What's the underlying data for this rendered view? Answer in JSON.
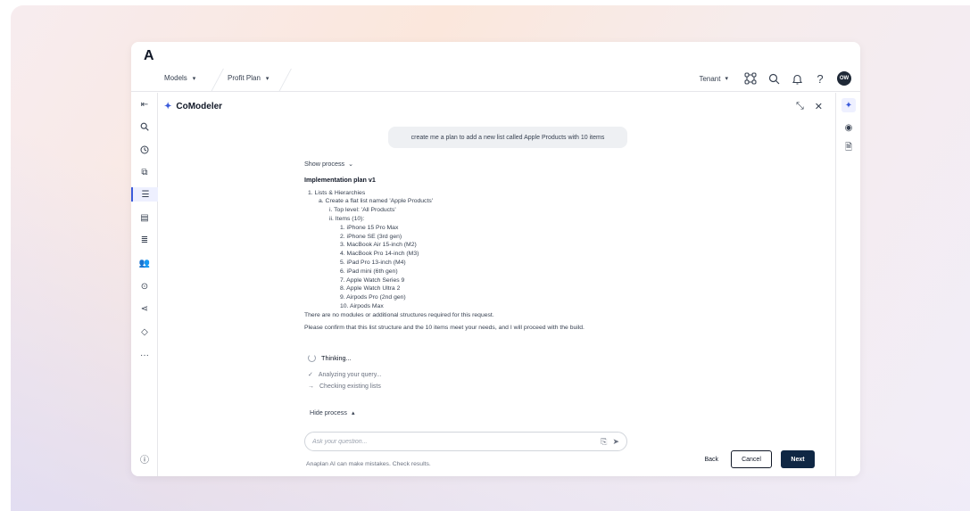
{
  "app": {
    "logo": "A"
  },
  "nav": {
    "items": [
      {
        "label": "Models"
      },
      {
        "label": "Profit Plan"
      }
    ],
    "tenant": "Tenant",
    "avatar_initials": "OW"
  },
  "panel": {
    "title": "CoModeler"
  },
  "chat": {
    "user_message": "create me a plan to add a new list called Apple Products with 10 items",
    "show_process": "Show process",
    "plan_title": "Implementation plan v1",
    "plan_lines": [
      {
        "level": 0,
        "text": "1. Lists & Hierarchies"
      },
      {
        "level": 1,
        "text": "a. Create a flat list named 'Apple Products'"
      },
      {
        "level": 2,
        "text": "i. Top level: 'All Products'"
      },
      {
        "level": 2,
        "text": "ii. Items (10):"
      },
      {
        "level": 3,
        "text": "1. iPhone 15 Pro Max"
      },
      {
        "level": 3,
        "text": "2. iPhone SE (3rd gen)"
      },
      {
        "level": 3,
        "text": "3. MacBook Air 15-inch (M2)"
      },
      {
        "level": 3,
        "text": "4. MacBook Pro 14-inch (M3)"
      },
      {
        "level": 3,
        "text": "5. iPad Pro 13-inch (M4)"
      },
      {
        "level": 3,
        "text": "6. iPad mini (6th gen)"
      },
      {
        "level": 3,
        "text": "7. Apple Watch Series 9"
      },
      {
        "level": 3,
        "text": "8. Apple Watch Ultra 2"
      },
      {
        "level": 3,
        "text": "9. Airpods Pro (2nd gen)"
      },
      {
        "level": 3,
        "text": "10. Airpods Max"
      }
    ],
    "no_modules": "There are no modules or additional structures required for this request.",
    "confirm": "Please confirm that this list structure and the 10 items meet your needs, and I will proceed with the build.",
    "thinking": "Thinking...",
    "steps": [
      {
        "icon": "✓",
        "text": "Analyzing your query..."
      },
      {
        "icon": "→",
        "text": "Checking existing lists"
      }
    ],
    "hide_process": "Hide process",
    "input_placeholder": "Ask your question...",
    "disclaimer": "Anaplan AI can make mistakes. Check results."
  },
  "actions": {
    "back": "Back",
    "cancel": "Cancel",
    "next": "Next"
  },
  "colors": {
    "primary_button": "#0f2744",
    "accent": "#3b5bdb"
  }
}
